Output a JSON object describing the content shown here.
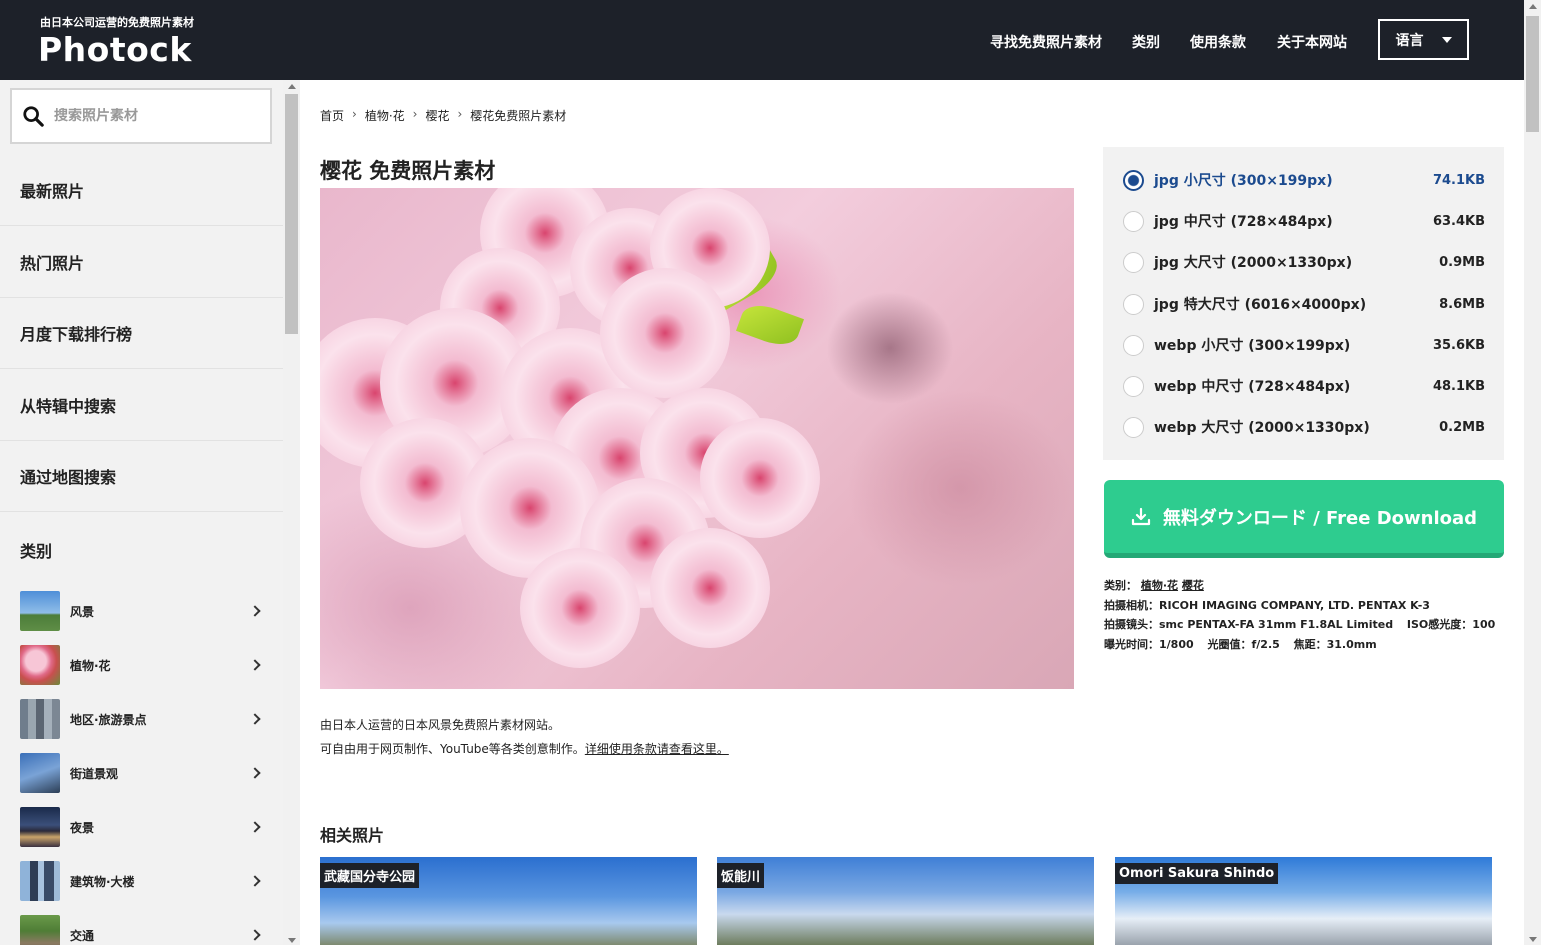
{
  "header": {
    "tagline": "由日本公司运营的免费照片素材",
    "logo": "Photock",
    "nav": [
      "寻找免费照片素材",
      "类别",
      "使用条款",
      "关于本网站"
    ],
    "language_label": "语言"
  },
  "sidebar": {
    "search_placeholder": "搜索照片素材",
    "items": [
      "最新照片",
      "热门照片",
      "月度下载排行榜",
      "从特辑中搜索",
      "通过地图搜索"
    ],
    "category_heading": "类别",
    "categories": [
      "风景",
      "植物·花",
      "地区·旅游景点",
      "街道景观",
      "夜景",
      "建筑物·大楼",
      "交通"
    ]
  },
  "breadcrumb": [
    "首页",
    "植物·花",
    "樱花",
    "樱花免费照片素材"
  ],
  "page_title": "樱花 免费照片素材",
  "description": {
    "line1": "由日本人运营的日本风景免费照片素材网站。",
    "line2": "可自由用于网页制作、YouTube等各类创意制作。",
    "link": "详细使用条款请查看这里。"
  },
  "sizes": [
    {
      "label": "jpg 小尺寸 (300×199px)",
      "size": "74.1KB",
      "selected": true
    },
    {
      "label": "jpg 中尺寸 (728×484px)",
      "size": "63.4KB",
      "selected": false
    },
    {
      "label": "jpg 大尺寸 (2000×1330px)",
      "size": "0.9MB",
      "selected": false
    },
    {
      "label": "jpg 特大尺寸 (6016×4000px)",
      "size": "8.6MB",
      "selected": false
    },
    {
      "label": "webp 小尺寸 (300×199px)",
      "size": "35.6KB",
      "selected": false
    },
    {
      "label": "webp 中尺寸 (728×484px)",
      "size": "48.1KB",
      "selected": false
    },
    {
      "label": "webp 大尺寸 (2000×1330px)",
      "size": "0.2MB",
      "selected": false
    }
  ],
  "download_label": "無料ダウンロード / Free Download",
  "meta": {
    "category_label": "类别：",
    "category_links": [
      "植物·花",
      "樱花"
    ],
    "camera": "拍摄相机：RICOH IMAGING COMPANY, LTD. PENTAX K-3",
    "lens": "拍摄镜头：smc PENTAX-FA 31mm F1.8AL Limited",
    "iso": "ISO感光度：100",
    "exposure": "曝光时间：1/800",
    "aperture": "光圈值：f/2.5",
    "focal": "焦距：31.0mm"
  },
  "related": {
    "title": "相关照片",
    "cards": [
      "武藏国分寺公园",
      "饭能川",
      "Omori Sakura Shindo"
    ]
  },
  "colors": {
    "header_bg": "#1d2129",
    "download_green": "#2ecc8f",
    "selected_blue": "#1c4b8f"
  }
}
